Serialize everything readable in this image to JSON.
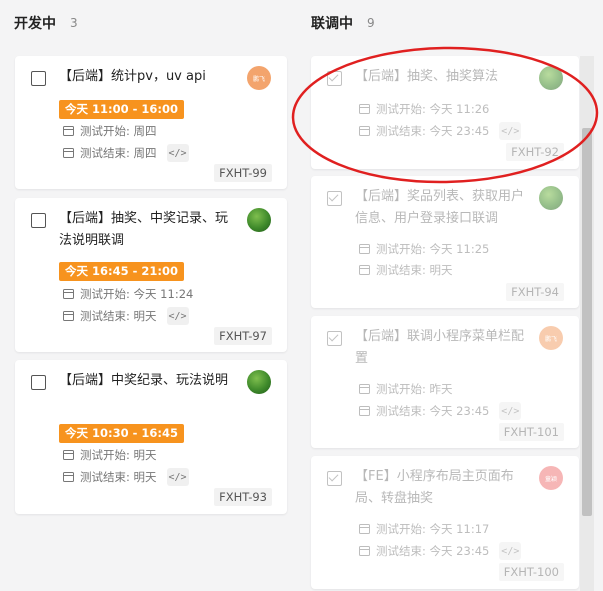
{
  "columns": [
    {
      "title": "开发中",
      "count": "3",
      "cards": [
        {
          "title": "【后端】统计pv，uv api",
          "time_badge": "今天 11:00 - 16:00",
          "start": "测试开始: 周四",
          "end": "测试结束: 周四",
          "ticket": "FXHT-99",
          "avatar_text": "鹏飞",
          "checked": false
        },
        {
          "title": "【后端】抽奖、中奖记录、玩法说明联调",
          "time_badge": "今天 16:45 - 21:00",
          "start": "测试开始: 今天 11:24",
          "end": "测试结束: 明天",
          "ticket": "FXHT-97",
          "avatar_text": "",
          "checked": false
        },
        {
          "title": "【后端】中奖纪录、玩法说明",
          "time_badge": "今天 10:30 - 16:45",
          "start": "测试开始: 明天",
          "end": "测试结束: 明天",
          "ticket": "FXHT-93",
          "avatar_text": "",
          "checked": false
        }
      ]
    },
    {
      "title": "联调中",
      "count": "9",
      "cards": [
        {
          "title": "【后端】抽奖、抽奖算法",
          "start": "测试开始: 今天 11:26",
          "end": "测试结束: 今天 23:45",
          "ticket": "FXHT-92",
          "avatar_text": "",
          "checked": true
        },
        {
          "title": "【后端】奖品列表、获取用户信息、用户登录接口联调",
          "start": "测试开始: 今天 11:25",
          "end": "测试结束: 明天",
          "ticket": "FXHT-94",
          "avatar_text": "",
          "checked": true
        },
        {
          "title": "【后端】联调小程序菜单栏配置",
          "start": "测试开始: 昨天",
          "end": "测试结束: 今天 23:45",
          "ticket": "FXHT-101",
          "avatar_text": "鹏飞",
          "checked": true
        },
        {
          "title": "【FE】小程序布局主页面布局、转盘抽奖",
          "start": "测试开始: 今天 11:17",
          "end": "测试结束: 今天 23:45",
          "ticket": "FXHT-100",
          "avatar_text": "童颖",
          "checked": true
        }
      ]
    }
  ],
  "icons": {
    "calendar": "calendar-icon",
    "code": "code-icon",
    "checkbox": "checkbox-icon"
  },
  "colors": {
    "time_badge": "#f7931e",
    "annotation": "#e02020",
    "background": "#f4f4f5"
  }
}
